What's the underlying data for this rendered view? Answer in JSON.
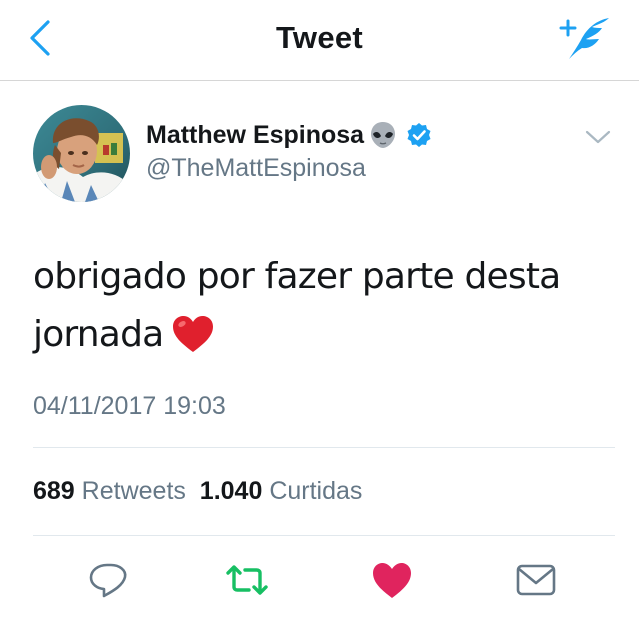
{
  "header": {
    "title": "Tweet",
    "accent_color": "#1da1f2"
  },
  "tweet": {
    "author_name": "Matthew Espinosa",
    "author_handle": "@TheMattEspinosa",
    "verified": true,
    "text_line1": "obrigado por fazer parte desta",
    "text_line2": "jornada",
    "timestamp": "04/11/2017 19:03",
    "retweets_count": "689",
    "retweets_label": "Retweets",
    "likes_count": "1.040",
    "likes_label": "Curtidas",
    "liked": true,
    "like_color": "#e0245e",
    "retweet_color": "#17bf63"
  },
  "icons": {
    "back": "chevron-left-icon",
    "compose": "compose-tweet-icon",
    "more": "chevron-down-icon",
    "reply": "reply-icon",
    "retweet": "retweet-icon",
    "like": "heart-icon",
    "dm": "envelope-icon"
  }
}
